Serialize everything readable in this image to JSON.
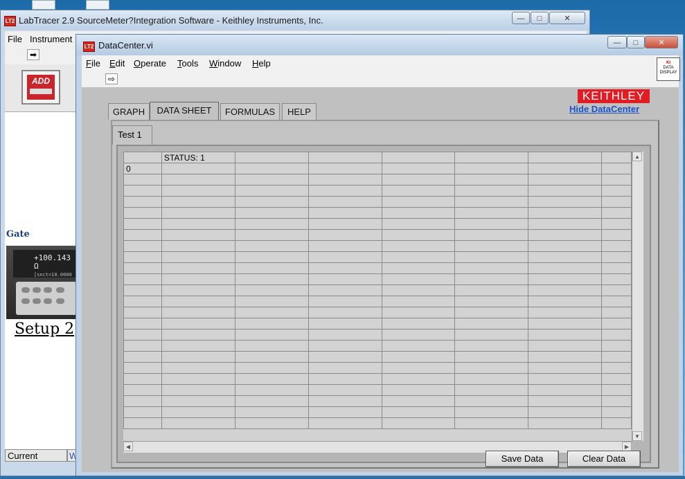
{
  "lab_window": {
    "title": "LabTracer 2.9  SourceMeter?Integration Software - Keithley Instruments, Inc.",
    "app_icon": "LT2",
    "menu": [
      "File",
      "Instrument"
    ],
    "tool_icon": "run-arrow-icon",
    "add_button_label": "ADD",
    "gate_label": "Gate",
    "meter_reading": "+100.143 Ω",
    "meter_sub": "[snct=10.0000",
    "setup_label": "Setup 2",
    "bottom_tabs": [
      "Current",
      "W"
    ],
    "caption_buttons": {
      "minimize": "—",
      "maximize": "□",
      "close": "✕"
    }
  },
  "datacenter_window": {
    "title": "DataCenter.vi",
    "app_icon": "LT2",
    "menu": [
      {
        "label": "File",
        "accel": "F"
      },
      {
        "label": "Edit",
        "accel": "E"
      },
      {
        "label": "Operate",
        "accel": "O"
      },
      {
        "label": "Tools",
        "accel": "T"
      },
      {
        "label": "Window",
        "accel": "W"
      },
      {
        "label": "Help",
        "accel": "H"
      }
    ],
    "caption_buttons": {
      "minimize": "—",
      "maximize": "□",
      "close": "✕"
    },
    "ki_display": {
      "line1": "KI",
      "line2": "DATA",
      "line3": "DISPLAY"
    },
    "brand": "KEITHLEY",
    "hide_link": "Hide DataCenter",
    "tabs": [
      "GRAPH",
      "DATA SHEET",
      "FORMULAS",
      "HELP"
    ],
    "active_tab": "DATA SHEET",
    "sub_tab": "Test 1",
    "sheet": {
      "header": [
        "",
        "STATUS: 1",
        "",
        "",
        "",
        "",
        "",
        ""
      ],
      "first_row": [
        "0",
        "",
        "",
        "",
        "",
        "",
        "",
        ""
      ],
      "row_count": 25
    },
    "buttons": {
      "save": "Save Data",
      "clear": "Clear Data"
    }
  }
}
